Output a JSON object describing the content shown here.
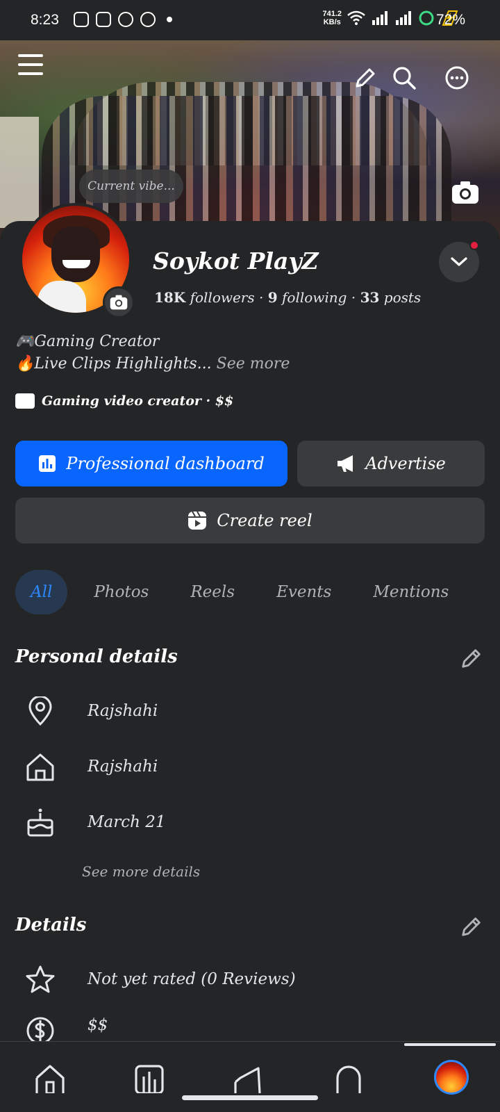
{
  "status_bar": {
    "time": "8:23",
    "speed_value": "741.2",
    "speed_unit": "KB/s",
    "battery": "72%"
  },
  "cover": {
    "vibe_placeholder": "Current vibe..."
  },
  "profile": {
    "name": "Soykot PlayZ",
    "followers_count": "18K",
    "followers_label": "followers",
    "following_count": "9",
    "following_label": "following",
    "posts_count": "33",
    "posts_label": "posts",
    "bio_line1": "🎮Gaming Creator",
    "bio_line2": "🔥Live Clips Highlights...",
    "see_more": "See more",
    "category": "Gaming video creator · $$"
  },
  "actions": {
    "professional_dashboard": "Professional dashboard",
    "advertise": "Advertise",
    "create_reel": "Create reel"
  },
  "tabs": [
    {
      "label": "All",
      "active": true
    },
    {
      "label": "Photos",
      "active": false
    },
    {
      "label": "Reels",
      "active": false
    },
    {
      "label": "Events",
      "active": false
    },
    {
      "label": "Mentions",
      "active": false
    }
  ],
  "personal_details": {
    "title": "Personal details",
    "location": "Rajshahi",
    "hometown": "Rajshahi",
    "birthday": "March 21",
    "see_more": "See more details"
  },
  "details": {
    "title": "Details",
    "rating": "Not yet rated (0 Reviews)",
    "price": "$$"
  },
  "colors": {
    "background": "#242526",
    "primary_button": "#0866ff",
    "secondary_button": "#3a3b3c",
    "active_tab_bg": "#263951",
    "active_tab_text": "#2d88ff",
    "notification_dot": "#e41e3f"
  }
}
